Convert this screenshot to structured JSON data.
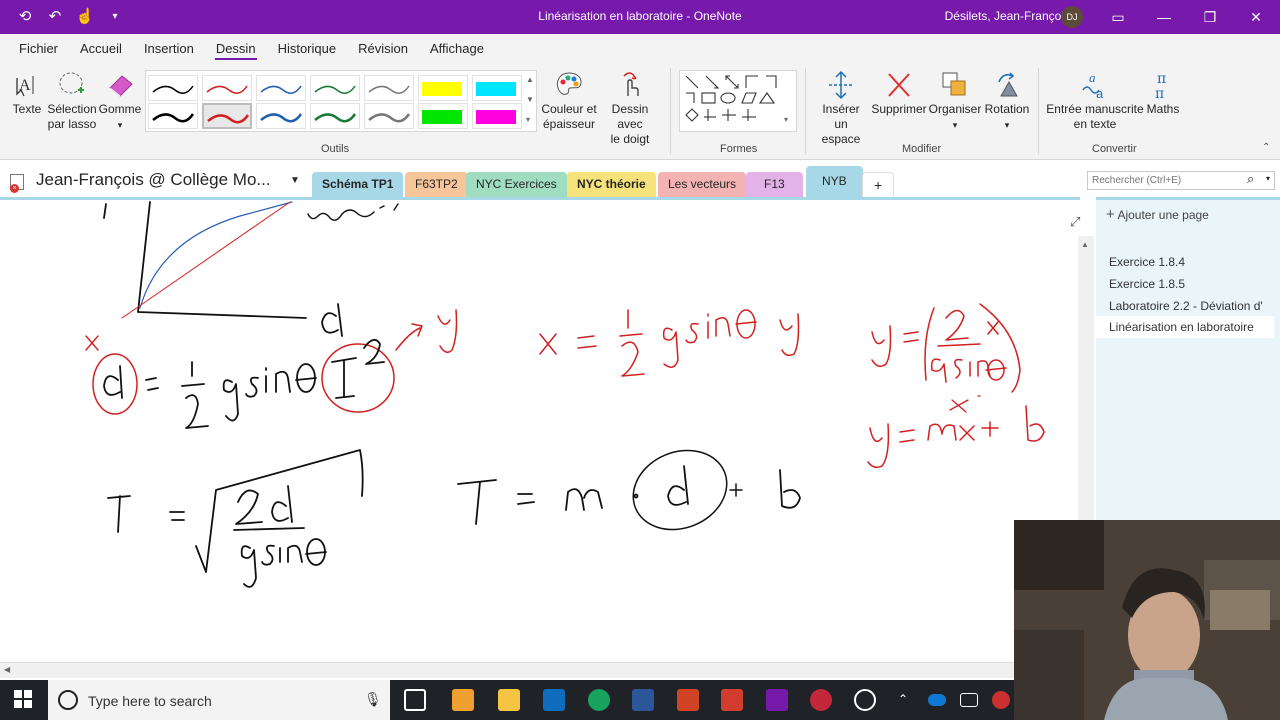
{
  "titlebar": {
    "title": "Linéarisation en laboratoire  -  OneNote",
    "user": "Désilets, Jean-François",
    "initials": "DJ",
    "accent": "#7719aa"
  },
  "ribbon_tabs": [
    "Fichier",
    "Accueil",
    "Insertion",
    "Dessin",
    "Historique",
    "Révision",
    "Affichage"
  ],
  "ribbon": {
    "tools": {
      "text": "Texte",
      "lasso_line1": "Sélection",
      "lasso_line2": "par lasso",
      "eraser": "Gomme",
      "group": "Outils"
    },
    "color": {
      "line1": "Couleur et",
      "line2": "épaisseur"
    },
    "finger": {
      "line1": "Dessin avec",
      "line2": "le doigt"
    },
    "shapes_group": "Formes",
    "modify": {
      "insert_space_line1": "Insérer un",
      "insert_space_line2": "espace",
      "delete": "Supprimer",
      "arrange": "Organiser",
      "rotate": "Rotation",
      "group": "Modifier"
    },
    "convert": {
      "ink_to_text_line1": "Entrée manuscrite",
      "ink_to_text_line2": "en texte",
      "math": "Maths",
      "group": "Convertir"
    }
  },
  "notebook": {
    "name": "Jean-François @ Collège Mo...",
    "sections": [
      {
        "label": "Schéma TP1",
        "color": "#a6d8e7",
        "bold": true
      },
      {
        "label": "F63TP2",
        "color": "#f6c59a",
        "bold": false
      },
      {
        "label": "NYC Exercices",
        "color": "#9fdcc0",
        "bold": false
      },
      {
        "label": "NYC théorie",
        "color": "#f6e27a",
        "bold": true
      },
      {
        "label": "Les vecteurs",
        "color": "#f4b3b3",
        "bold": false
      },
      {
        "label": "F13",
        "color": "#e3b2e8",
        "bold": false
      },
      {
        "label": "NYB",
        "color": "#a6d8e7",
        "bold": false
      },
      {
        "label": "+",
        "color": "#ffffff",
        "bold": false
      }
    ],
    "search_placeholder": "Rechercher (Ctrl+E)"
  },
  "pages": {
    "add_label": "Ajouter une page",
    "items": [
      "Exercice 1.8.4",
      "Exercice 1.8.5",
      "Laboratoire 2.2 - Déviation d'",
      "Linéarisation en laboratoire"
    ],
    "selected_index": 3
  },
  "taskbar": {
    "search_text": "Type here to search"
  }
}
